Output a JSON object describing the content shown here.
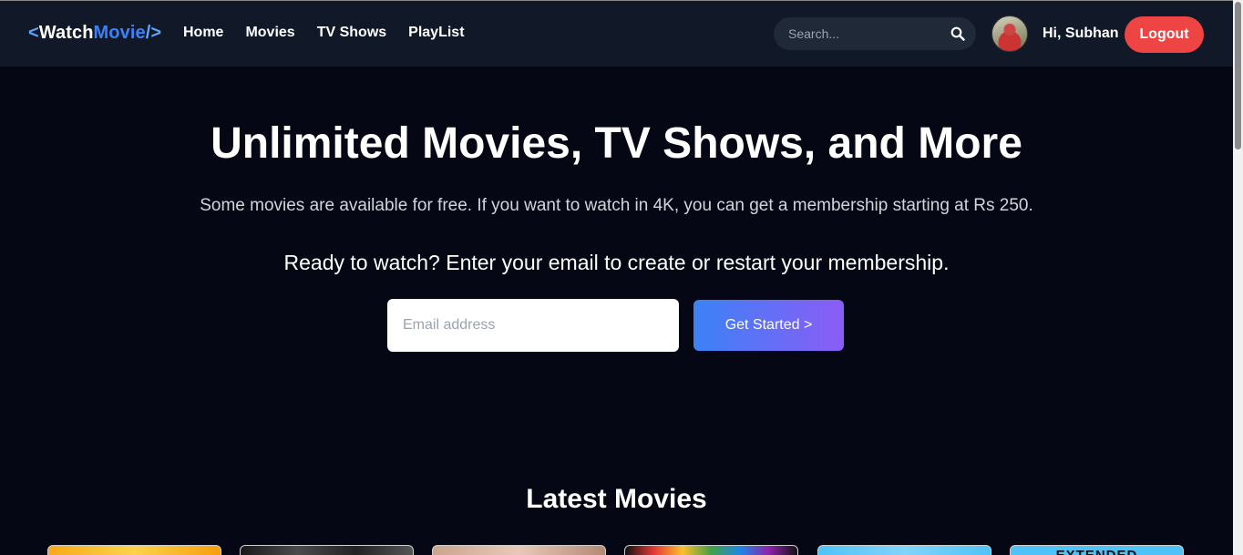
{
  "header": {
    "logo": {
      "open": "<",
      "part1": "Watch",
      "part2": "Movie",
      "close": "/>"
    },
    "nav": [
      {
        "label": "Home"
      },
      {
        "label": "Movies"
      },
      {
        "label": "TV Shows"
      },
      {
        "label": "PlayList"
      }
    ],
    "search": {
      "placeholder": "Search...",
      "value": ""
    },
    "user": {
      "greeting": "Hi, Subhan"
    },
    "logout_label": "Logout"
  },
  "hero": {
    "title": "Unlimited Movies, TV Shows, and More",
    "subtitle": "Some movies are available for free. If you want to watch in 4K, you can get a membership starting at Rs 250.",
    "cta_text": "Ready to watch? Enter your email to create or restart your membership.",
    "email_placeholder": "Email address",
    "button_label": "Get Started >"
  },
  "latest": {
    "title": "Latest Movies",
    "cards": [
      {
        "text": ""
      },
      {
        "text": ""
      },
      {
        "text": ""
      },
      {
        "text": ""
      },
      {
        "text": ""
      },
      {
        "text": "EXTENDED"
      }
    ]
  },
  "colors": {
    "background": "#050714",
    "navbar": "#111827",
    "accent_blue": "#3b82f6",
    "logout": "#ef4444",
    "button_gradient_start": "#3b82f6",
    "button_gradient_end": "#8b5cf6"
  },
  "icons": {
    "search": "search-icon"
  }
}
